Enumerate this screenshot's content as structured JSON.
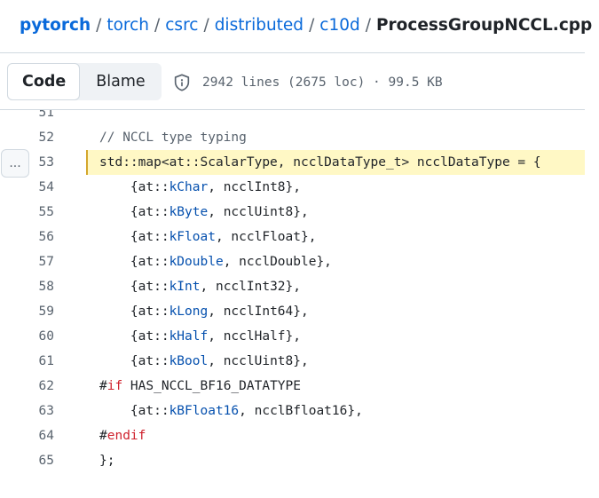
{
  "breadcrumb": {
    "items": [
      "pytorch",
      "torch",
      "csrc",
      "distributed",
      "c10d"
    ],
    "separator": "/",
    "current": "ProcessGroupNCCL.cpp"
  },
  "toolbar": {
    "code_label": "Code",
    "blame_label": "Blame",
    "file_info": "2942 lines (2675 loc) · 99.5 KB",
    "icon": "shield-icon"
  },
  "code_view": {
    "more_label": "...",
    "highlighted_line": "53",
    "lines": [
      {
        "num": "51",
        "tokens": []
      },
      {
        "num": "52",
        "tokens": [
          {
            "t": "// NCCL type typing",
            "c": "comment"
          }
        ]
      },
      {
        "num": "53",
        "tokens": [
          {
            "t": "std::map<at::ScalarType, ncclDataType_t> ncclDataType = {",
            "c": ""
          }
        ]
      },
      {
        "num": "54",
        "tokens": [
          {
            "t": "    {at::",
            "c": ""
          },
          {
            "t": "kChar",
            "c": "blue"
          },
          {
            "t": ", ncclInt8},",
            "c": ""
          }
        ]
      },
      {
        "num": "55",
        "tokens": [
          {
            "t": "    {at::",
            "c": ""
          },
          {
            "t": "kByte",
            "c": "blue"
          },
          {
            "t": ", ncclUint8},",
            "c": ""
          }
        ]
      },
      {
        "num": "56",
        "tokens": [
          {
            "t": "    {at::",
            "c": ""
          },
          {
            "t": "kFloat",
            "c": "blue"
          },
          {
            "t": ", ncclFloat},",
            "c": ""
          }
        ]
      },
      {
        "num": "57",
        "tokens": [
          {
            "t": "    {at::",
            "c": ""
          },
          {
            "t": "kDouble",
            "c": "blue"
          },
          {
            "t": ", ncclDouble},",
            "c": ""
          }
        ]
      },
      {
        "num": "58",
        "tokens": [
          {
            "t": "    {at::",
            "c": ""
          },
          {
            "t": "kInt",
            "c": "blue"
          },
          {
            "t": ", ncclInt32},",
            "c": ""
          }
        ]
      },
      {
        "num": "59",
        "tokens": [
          {
            "t": "    {at::",
            "c": ""
          },
          {
            "t": "kLong",
            "c": "blue"
          },
          {
            "t": ", ncclInt64},",
            "c": ""
          }
        ]
      },
      {
        "num": "60",
        "tokens": [
          {
            "t": "    {at::",
            "c": ""
          },
          {
            "t": "kHalf",
            "c": "blue"
          },
          {
            "t": ", ncclHalf},",
            "c": ""
          }
        ]
      },
      {
        "num": "61",
        "tokens": [
          {
            "t": "    {at::",
            "c": ""
          },
          {
            "t": "kBool",
            "c": "blue"
          },
          {
            "t": ", ncclUint8},",
            "c": ""
          }
        ]
      },
      {
        "num": "62",
        "tokens": [
          {
            "t": "#",
            "c": ""
          },
          {
            "t": "if",
            "c": "red"
          },
          {
            "t": " HAS_NCCL_BF16_DATATYPE",
            "c": ""
          }
        ]
      },
      {
        "num": "63",
        "tokens": [
          {
            "t": "    {at::",
            "c": ""
          },
          {
            "t": "kBFloat16",
            "c": "blue"
          },
          {
            "t": ", ncclBfloat16},",
            "c": ""
          }
        ]
      },
      {
        "num": "64",
        "tokens": [
          {
            "t": "#",
            "c": ""
          },
          {
            "t": "endif",
            "c": "red"
          }
        ]
      },
      {
        "num": "65",
        "tokens": [
          {
            "t": "};",
            "c": ""
          }
        ]
      }
    ]
  },
  "colors": {
    "link": "#0969da",
    "highlight_bg": "#fff8c5",
    "highlight_border": "#d4a72c",
    "keyword_blue": "#0550ae",
    "keyword_red": "#cf222e",
    "muted": "#59636e"
  }
}
